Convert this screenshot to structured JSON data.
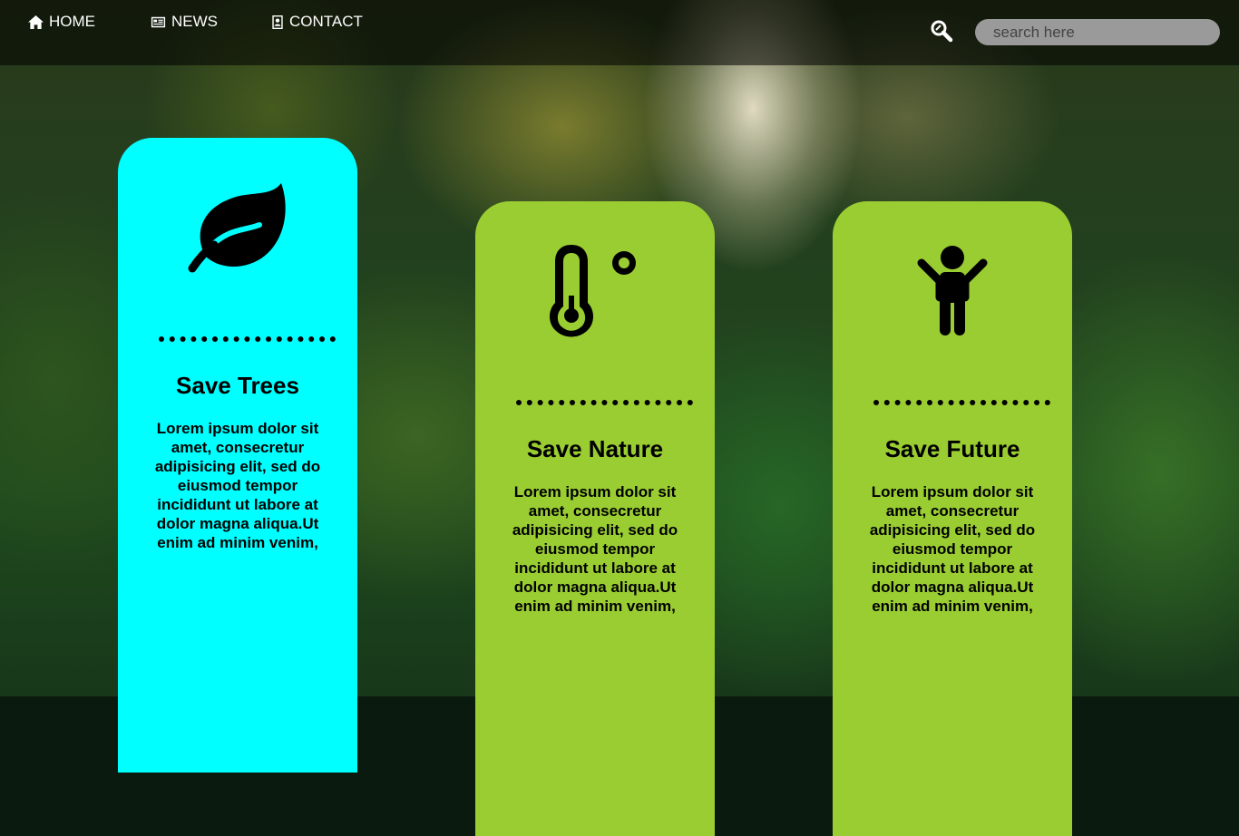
{
  "nav": {
    "items": [
      {
        "label": "HOME",
        "icon": "home-icon"
      },
      {
        "label": "NEWS",
        "icon": "newspaper-icon"
      },
      {
        "label": "CONTACT",
        "icon": "contact-card-icon"
      }
    ],
    "search": {
      "placeholder": "search here",
      "value": "",
      "icon": "search-icon"
    }
  },
  "cards": [
    {
      "title": "Save Trees",
      "text": "Lorem ipsum dolor sit amet, consecretur adipisicing elit, sed do eiusmod tempor incididunt ut labore at dolor magna aliqua.Ut enim ad minim venim,",
      "icon": "leaf-icon",
      "color": "#00ffff"
    },
    {
      "title": "Save Nature",
      "text": "Lorem ipsum dolor sit amet, consecretur adipisicing elit, sed do eiusmod tempor incididunt ut labore at dolor magna aliqua.Ut enim ad minim venim,",
      "icon": "thermometer-icon",
      "color": "#9acd32"
    },
    {
      "title": "Save Future",
      "text": "Lorem ipsum dolor sit amet, consecretur adipisicing elit, sed do eiusmod tempor incididunt ut labore at dolor magna aliqua.Ut enim ad minim venim,",
      "icon": "child-icon",
      "color": "#9acd32"
    }
  ]
}
